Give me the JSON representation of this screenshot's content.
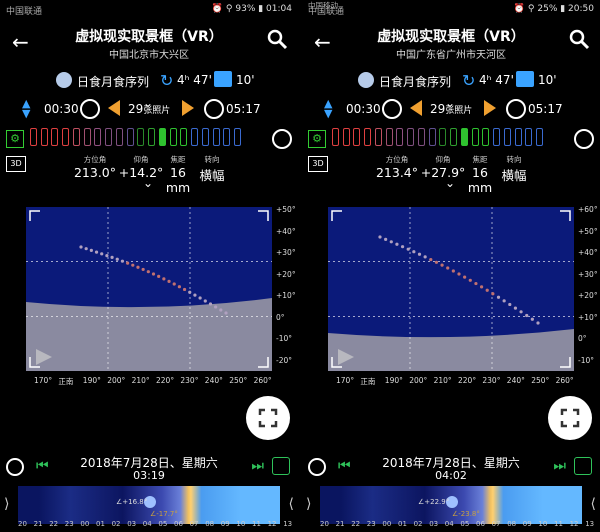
{
  "panels": [
    {
      "status": {
        "carrier": "中国联通",
        "carrier2": "",
        "right": "⏰ ⚲ 93% ▮ 01:04"
      },
      "title": "虚拟现实取景框（VR）",
      "subtitle": "中国北京市大兴区",
      "sequence_label": "日食月食序列",
      "duration": "4ʰ 47'",
      "interval": "10'",
      "start_time": "00:30",
      "photo_count": "29",
      "photo_count_unit": "张照片",
      "end_time": "05:17",
      "labels": {
        "azimuth": "方位角",
        "elevation": "仰角",
        "focal": "焦距",
        "orientation": "转向"
      },
      "azimuth": "213.0°",
      "elevation": "+14.2°",
      "focal": "16 mm",
      "orientation": "横幅",
      "y_ticks": [
        "+50°",
        "+40°",
        "+30°",
        "+20°",
        "+10°",
        "0°",
        "-10°",
        "-20°"
      ],
      "x_ticks": [
        "170°",
        "正南",
        "190°",
        "200°",
        "210°",
        "220°",
        "230°",
        "240°",
        "250°",
        "260°"
      ],
      "date": "2018年7月28日、星期六",
      "time": "03:19",
      "sun_angle": "∠+16.8°",
      "moon_angle": "∠-17.7°",
      "timeline_ticks": [
        "20",
        "21",
        "22",
        "23",
        "00",
        "01",
        "02",
        "03",
        "04",
        "05",
        "06",
        "07",
        "08",
        "09",
        "10",
        "11",
        "12",
        "13"
      ]
    },
    {
      "status": {
        "carrier": "中国联通",
        "carrier2": "中国移动",
        "right": "⏰ ⚲ 25% ▮ 20:50"
      },
      "title": "虚拟现实取景框（VR）",
      "subtitle": "中国广东省广州市天河区",
      "sequence_label": "日食月食序列",
      "duration": "4ʰ 47'",
      "interval": "10'",
      "start_time": "00:30",
      "photo_count": "29",
      "photo_count_unit": "张照片",
      "end_time": "05:17",
      "labels": {
        "azimuth": "方位角",
        "elevation": "仰角",
        "focal": "焦距",
        "orientation": "转向"
      },
      "azimuth": "213.4°",
      "elevation": "+27.9°",
      "focal": "16 mm",
      "orientation": "横幅",
      "y_ticks": [
        "+60°",
        "+50°",
        "+40°",
        "+30°",
        "+20°",
        "+10°",
        "0°",
        "-10°"
      ],
      "x_ticks": [
        "170°",
        "正南",
        "190°",
        "200°",
        "210°",
        "220°",
        "230°",
        "240°",
        "250°",
        "260°"
      ],
      "date": "2018年7月28日、星期六",
      "time": "04:02",
      "sun_angle": "∠+22.9°",
      "moon_angle": "∠-23.8°",
      "timeline_ticks": [
        "20",
        "21",
        "22",
        "23",
        "00",
        "01",
        "02",
        "03",
        "04",
        "05",
        "06",
        "07",
        "08",
        "09",
        "10",
        "11",
        "12",
        "13"
      ]
    }
  ],
  "colors": {
    "accent": "#3aa3ff",
    "orange": "#f0a030",
    "green": "#2fc25a",
    "sky": "#0b1a7a"
  }
}
